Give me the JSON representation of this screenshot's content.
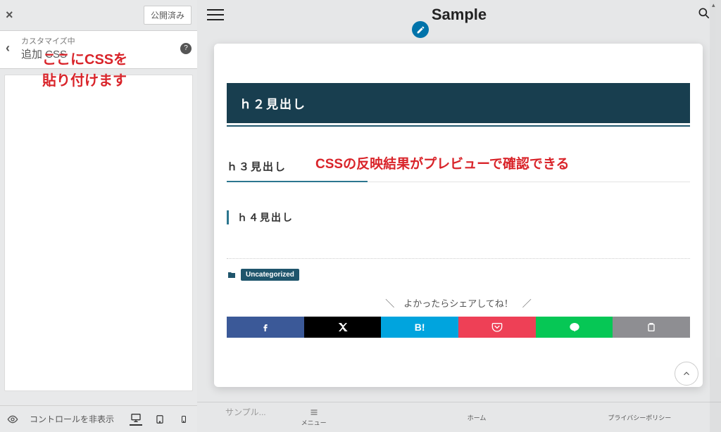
{
  "customizer": {
    "publish": "公開済み",
    "breadcrumb_small": "カスタマイズ中",
    "breadcrumb_big": "追加 CSS",
    "hide_controls": "コントロールを非表示"
  },
  "annotation": {
    "left_l1": "ここにCSSを",
    "left_l2": "貼り付けます",
    "right": "CSSの反映結果がプレビューで確認できる"
  },
  "site": {
    "title": "Sample",
    "h2": "ｈ２見出し",
    "h3": "ｈ３見出し",
    "h4": "ｈ４見出し",
    "category": "Uncategorized",
    "share_cta": "＼　よかったらシェアしてね！　／",
    "bottom_placeholder": "サンプル..."
  },
  "bottomnav": {
    "menu": "メニュー",
    "home": "ホーム",
    "privacy": "プライバシーポリシー"
  },
  "icons": {
    "share_b_letter": "B!"
  }
}
